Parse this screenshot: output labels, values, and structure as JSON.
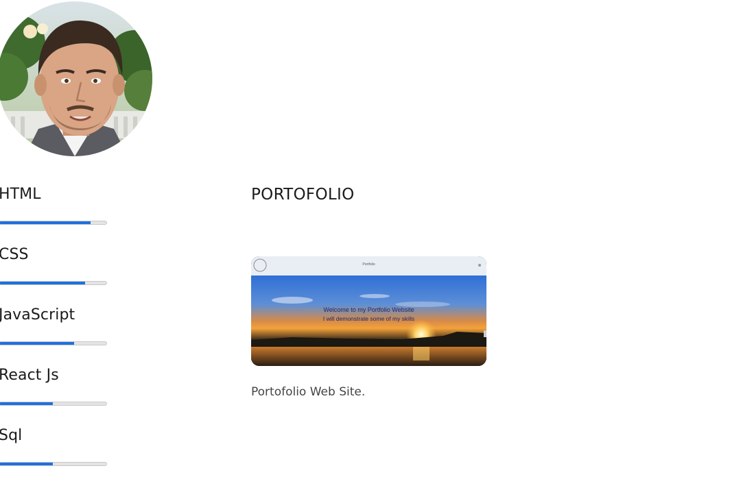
{
  "skills": [
    {
      "label": "HTML",
      "level": 0.85
    },
    {
      "label": "CSS",
      "level": 0.8
    },
    {
      "label": "JavaScript",
      "level": 0.7
    },
    {
      "label": "React Js",
      "level": 0.5
    },
    {
      "label": "Sql",
      "level": 0.5
    }
  ],
  "portfolio": {
    "title": "PORTOFOLIO",
    "projects": [
      {
        "caption": "Portofolio Web Site.",
        "thumbnail": {
          "window_title": "Portfolio",
          "headline": "Welcome to my Portfolio Website",
          "subline": "I will demonstrate some of my skills"
        }
      }
    ]
  },
  "colors": {
    "accent": "#1f6fe0",
    "bar_track": "#e4e4e4"
  }
}
